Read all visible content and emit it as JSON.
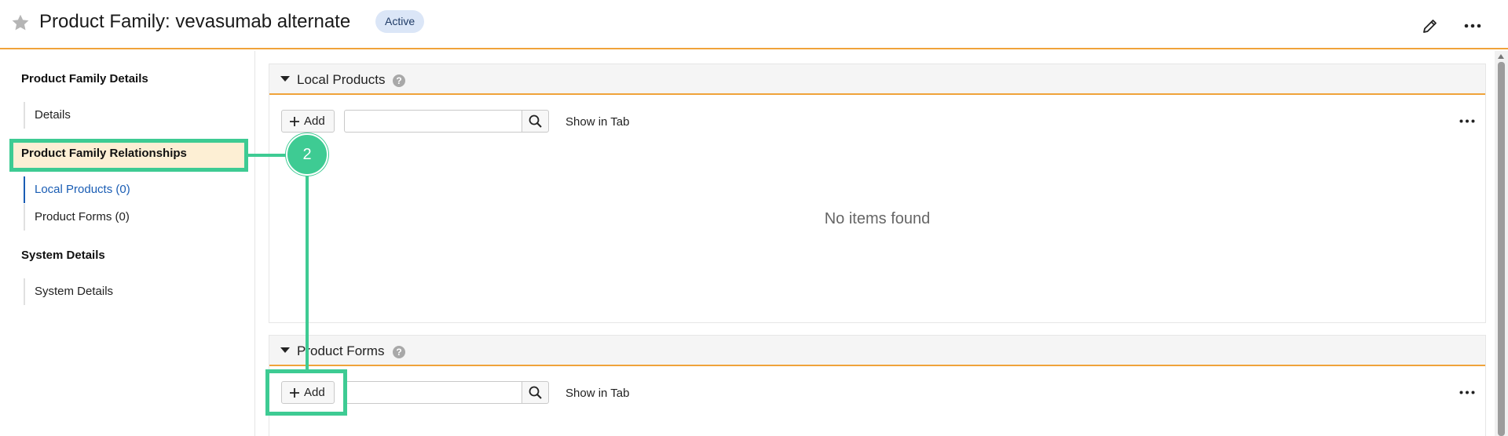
{
  "header": {
    "title": "Product Family: vevasumab alternate",
    "status_badge": "Active",
    "icons": {
      "favorite": "star-icon",
      "edit": "pencil-icon",
      "more": "ellipsis-icon"
    }
  },
  "sidebar": {
    "sections": [
      {
        "heading": "Product Family Details",
        "items": [
          "Details"
        ]
      },
      {
        "heading": "Product Family Relationships",
        "items": [
          "Local Products (0)",
          "Product Forms (0)"
        ]
      },
      {
        "heading": "System Details",
        "items": [
          "System Details"
        ]
      }
    ],
    "active_item": "Local Products (0)"
  },
  "main": {
    "sections": [
      {
        "title": "Local Products",
        "add_label": "Add",
        "search_placeholder": "",
        "show_in_tab": "Show in Tab",
        "empty_message": "No items found"
      },
      {
        "title": "Product Forms",
        "add_label": "Add",
        "search_placeholder": "",
        "show_in_tab": "Show in Tab"
      }
    ],
    "help_glyph": "?"
  },
  "annotation": {
    "step_number": "2"
  },
  "colors": {
    "accent_orange": "#f0a33a",
    "annotation_green": "#3ecb93",
    "highlight": "#fdefd4",
    "link_blue": "#1a5db4",
    "badge_bg": "#dbe6f7"
  }
}
